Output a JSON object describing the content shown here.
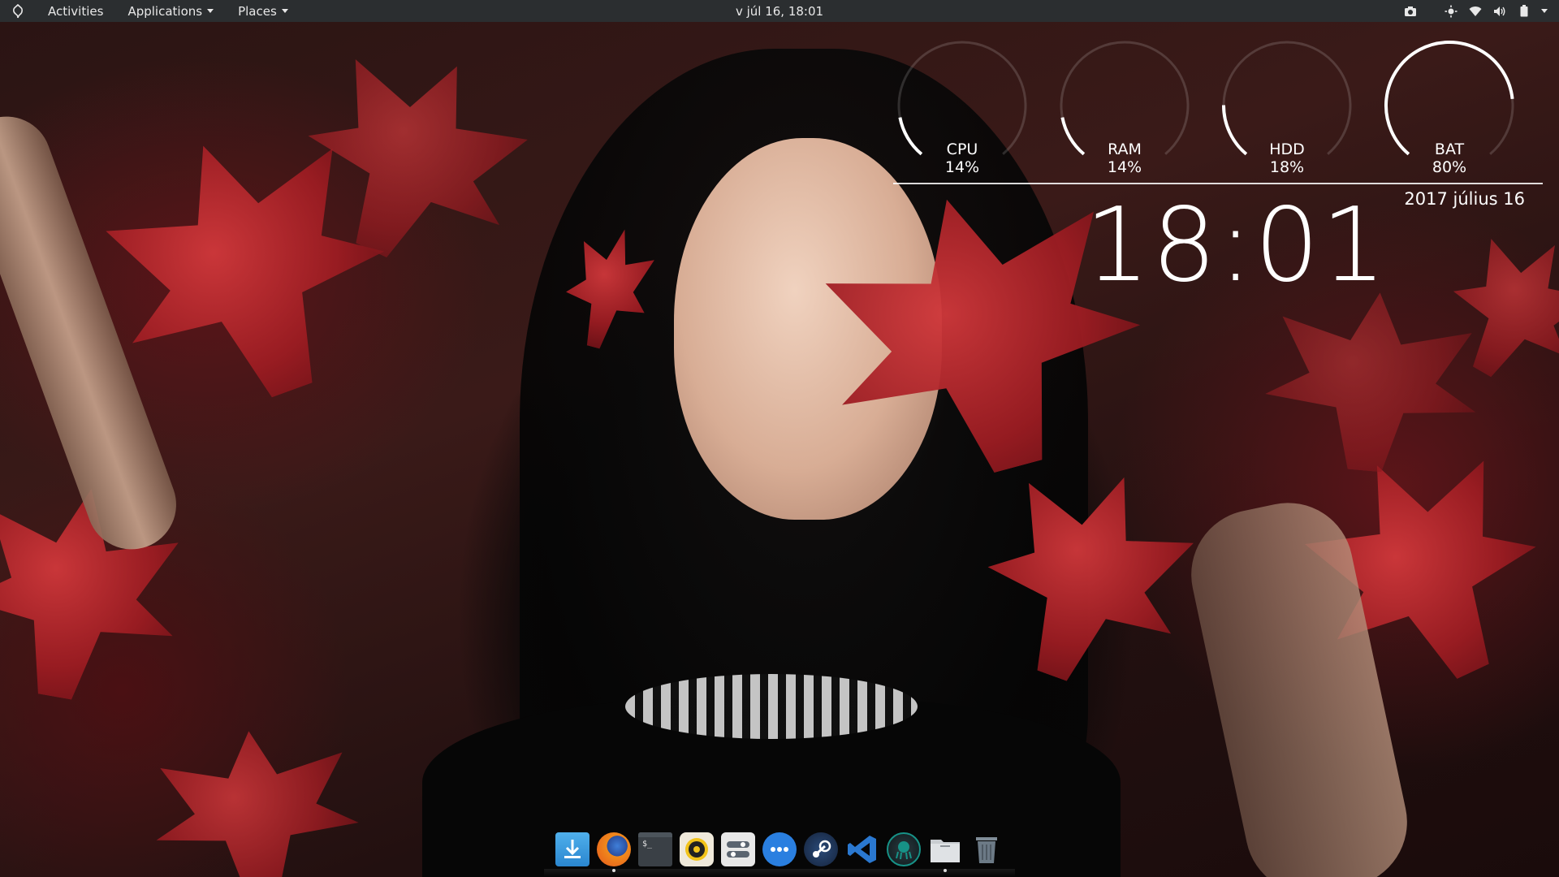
{
  "top_bar": {
    "activities_label": "Activities",
    "applications_label": "Applications",
    "places_label": "Places",
    "clock": "v júl 16, 18:01",
    "tray_icons": [
      "screenshot-icon",
      "brightness-icon",
      "wifi-icon",
      "volume-icon",
      "battery-icon",
      "menu-caret-icon"
    ]
  },
  "conky": {
    "gauges": [
      {
        "name": "CPU",
        "value": "14%",
        "fraction": 0.14
      },
      {
        "name": "RAM",
        "value": "14%",
        "fraction": 0.14
      },
      {
        "name": "HDD",
        "value": "18%",
        "fraction": 0.18
      },
      {
        "name": "BAT",
        "value": "80%",
        "fraction": 0.8
      }
    ],
    "date": "2017 július 16",
    "time": "18:01",
    "color": "#ffffff"
  },
  "dock": {
    "items": [
      {
        "name": "downloads-folder-icon",
        "color": "#3a9be0"
      },
      {
        "name": "firefox-icon",
        "color": "#f08a1c"
      },
      {
        "name": "terminal-icon",
        "color": "#3a4046"
      },
      {
        "name": "audio-player-icon",
        "color": "#f2c31a"
      },
      {
        "name": "settings-icon",
        "color": "#e8e8e8"
      },
      {
        "name": "messaging-icon",
        "color": "#2a7fe0"
      },
      {
        "name": "steam-icon",
        "color": "#1b2838"
      },
      {
        "name": "vscode-icon",
        "color": "#2a78d0"
      },
      {
        "name": "gitkraken-icon",
        "color": "#179287"
      },
      {
        "name": "files-icon",
        "color": "#c9cdd1"
      },
      {
        "name": "trash-icon",
        "color": "#6c7a86"
      }
    ]
  }
}
